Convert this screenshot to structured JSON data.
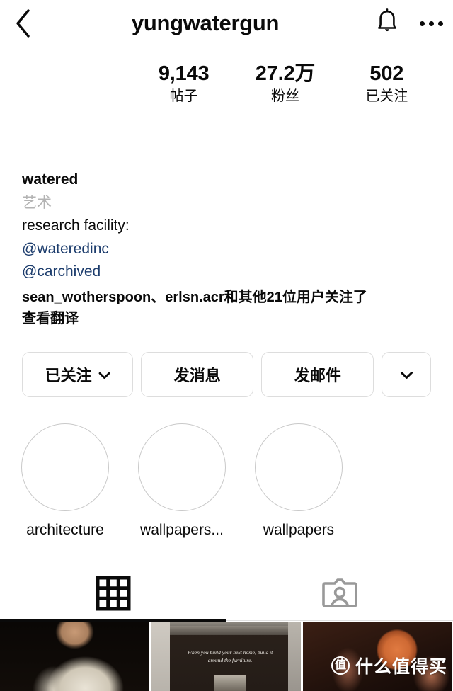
{
  "topbar": {
    "back_icon": "chevron-left-icon",
    "username": "yungwatergun",
    "bell_icon": "notification-bell-icon",
    "more_icon": "more-options-icon"
  },
  "stats": [
    {
      "value": "9,143",
      "label": "帖子"
    },
    {
      "value": "27.2万",
      "label": "粉丝"
    },
    {
      "value": "502",
      "label": "已关注"
    }
  ],
  "bio": {
    "name": "watered",
    "category": "艺术",
    "line1": "research facility:",
    "link1": "@wateredinc",
    "link2": "@carchived",
    "mutuals": "sean_wotherspoon、erlsn.acr和其他21位用户关注了",
    "translate": "查看翻译"
  },
  "actions": {
    "follow": "已关注",
    "message": "发消息",
    "email": "发邮件",
    "more_icon": "chevron-down-icon"
  },
  "highlights": [
    {
      "label": "architecture"
    },
    {
      "label": "wallpapers..."
    },
    {
      "label": "wallpapers"
    }
  ],
  "tabs": [
    {
      "name": "grid-tab",
      "icon": "grid-icon",
      "active": true
    },
    {
      "name": "tagged-tab",
      "icon": "tagged-person-icon",
      "active": false
    }
  ],
  "grid": [
    {
      "alt": "portrait in white hoodie on dark background"
    },
    {
      "alt": "architecture interior with quote",
      "quote": "When you build your next home, build it around the furniture."
    },
    {
      "alt": "hands holding a basketball"
    }
  ],
  "watermark": {
    "badge": "值",
    "text": "什么值得买"
  },
  "colors": {
    "text": "#0a0a0a",
    "muted": "#b3b3b3",
    "link": "#1d3d6d",
    "border": "#dddddd",
    "ring": "#c9c9c9"
  }
}
